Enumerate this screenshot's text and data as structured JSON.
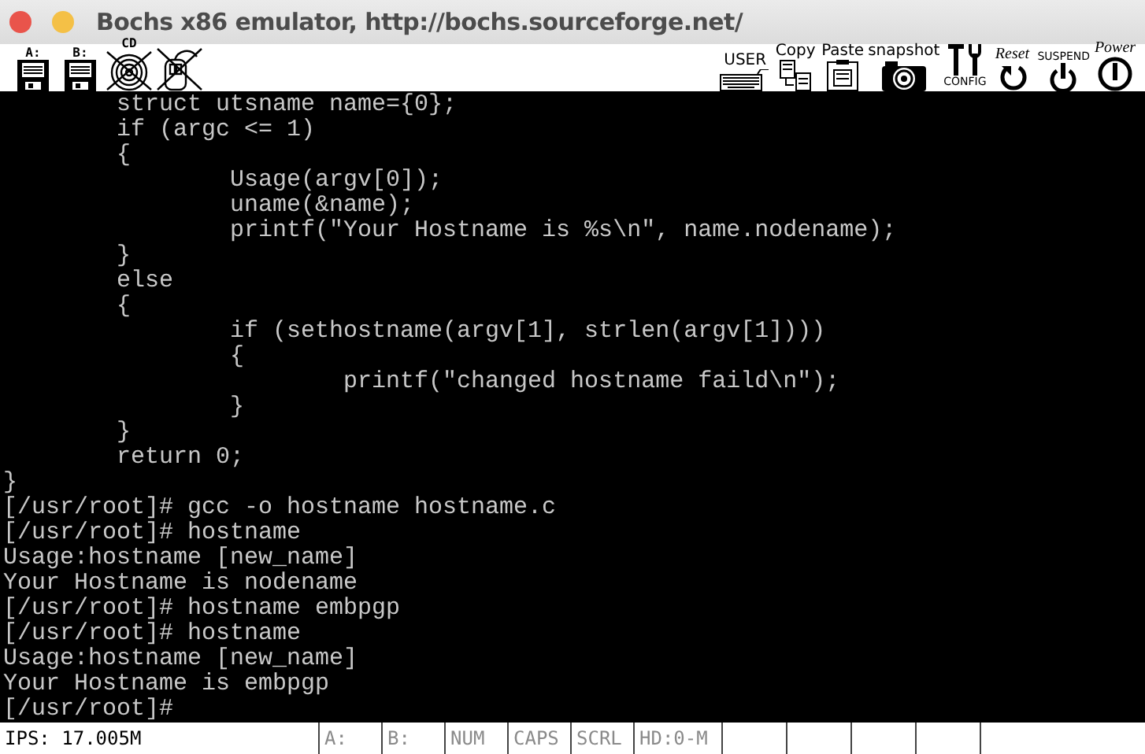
{
  "window": {
    "title": "Bochs x86 emulator, http://bochs.sourceforge.net/"
  },
  "toolbar": {
    "left": [
      {
        "kind": "floppy",
        "label": "A:"
      },
      {
        "kind": "floppy",
        "label": "B:"
      },
      {
        "kind": "cdrom",
        "label": "CD"
      },
      {
        "kind": "mouse"
      }
    ],
    "right": [
      {
        "kind": "keyboard",
        "label": "USER"
      },
      {
        "kind": "copy",
        "label": "Copy"
      },
      {
        "kind": "paste",
        "label": "Paste"
      },
      {
        "kind": "camera",
        "label": "snapshot"
      },
      {
        "kind": "config",
        "label": "CONFIG"
      },
      {
        "kind": "reset",
        "label": "Reset"
      },
      {
        "kind": "suspend",
        "label": "SUSPEND"
      },
      {
        "kind": "power",
        "label": "Power"
      }
    ]
  },
  "terminal": {
    "lines": [
      "        struct utsname name={0};",
      "        if (argc <= 1)",
      "        {",
      "                Usage(argv[0]);",
      "                uname(&name);",
      "                printf(\"Your Hostname is %s\\n\", name.nodename);",
      "        }",
      "        else",
      "        {",
      "                if (sethostname(argv[1], strlen(argv[1])))",
      "                {",
      "                        printf(\"changed hostname faild\\n\");",
      "                }",
      "        }",
      "        return 0;",
      "}",
      "[/usr/root]# gcc -o hostname hostname.c",
      "[/usr/root]# hostname",
      "Usage:hostname [new_name]",
      "Your Hostname is nodename",
      "[/usr/root]# hostname embpgp",
      "[/usr/root]# hostname",
      "Usage:hostname [new_name]",
      "Your Hostname is embpgp",
      "[/usr/root]#"
    ]
  },
  "status_bar": {
    "ips": "IPS: 17.005M",
    "indicators": [
      {
        "label": "A:",
        "on": false
      },
      {
        "label": "B:",
        "on": false
      },
      {
        "label": "NUM",
        "on": false
      },
      {
        "label": "CAPS",
        "on": false
      },
      {
        "label": "SCRL",
        "on": false
      },
      {
        "label": "HD:0-M",
        "on": false
      }
    ]
  }
}
